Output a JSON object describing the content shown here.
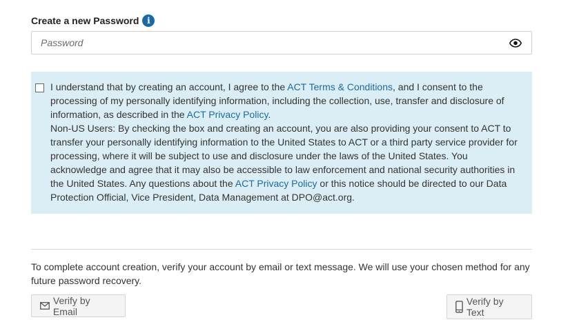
{
  "password": {
    "label": "Create a new Password",
    "info_icon": "info-icon",
    "placeholder": "Password",
    "toggle_icon": "eye-icon"
  },
  "consent": {
    "p1_before": "I understand that by creating an account, I agree to the ",
    "terms_link": "ACT Terms & Conditions",
    "p1_middle": ", and I consent to the processing of my personally identifying information, including the collection, use, transfer and disclosure of information, as described in the ",
    "privacy_link_1": "ACT Privacy Policy",
    "p1_end": ".",
    "p2_before": "Non-US Users: By checking the box and creating an account, you are also providing your consent to ACT to transfer your personally identifying information to the United States to ACT or a third party service provider for processing, where it will be subject to use and disclosure under the laws of the United States. You acknowledge and agree that it may also be accessible to law enforcement and national security authorities in the United States. Any questions about the ",
    "privacy_link_2": "ACT Privacy Policy",
    "p2_after": " or this notice should be directed to our Data Protection Official, Vice President, Data Management at DPO@act.org."
  },
  "verify": {
    "info": "To complete account creation, verify your account by email or text message. We will use your chosen method for any future password recovery.",
    "email_button": "Verify by Email",
    "email_icon": "envelope-icon",
    "text_button": "Verify by Text",
    "text_icon": "mobile-phone-icon"
  },
  "colors": {
    "link": "#1a6aa6",
    "consent_background": "#dbeef6",
    "button_background": "#f4f4f4"
  }
}
